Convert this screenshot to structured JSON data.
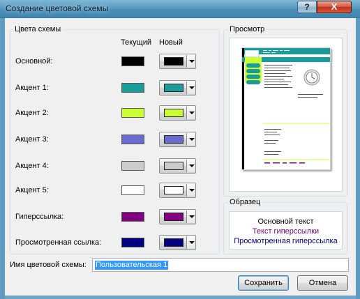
{
  "window": {
    "title": "Создание цветовой схемы",
    "help_glyph": "?",
    "close_glyph": "X"
  },
  "scheme_colors": {
    "group_label": "Цвета схемы",
    "current_header": "Текущий",
    "new_header": "Новый",
    "rows": [
      {
        "label": "Основной:",
        "current": "#000000",
        "new": "#000000"
      },
      {
        "label": "Акцент 1:",
        "current": "#1a9c9a",
        "new": "#1a9c9a"
      },
      {
        "label": "Акцент 2:",
        "current": "#ccff33",
        "new": "#ccff33"
      },
      {
        "label": "Акцент 3:",
        "current": "#6b6bcf",
        "new": "#6b6bcf"
      },
      {
        "label": "Акцент 4:",
        "current": "#cccccc",
        "new": "#cccccc"
      },
      {
        "label": "Акцент 5:",
        "current": "#ffffff",
        "new": "#ffffff"
      },
      {
        "label": "Гиперссылка:",
        "current": "#800080",
        "new": "#800080"
      },
      {
        "label": "Просмотренная ссылка:",
        "current": "#000080",
        "new": "#000080"
      }
    ]
  },
  "preview": {
    "group_label": "Просмотр",
    "accent_teal": "#1a9c9a",
    "accent_lime": "#ccff33"
  },
  "sample": {
    "group_label": "Образец",
    "main_text": "Основной текст",
    "hyperlink_text": "Текст гиперссылки",
    "visited_text": "Просмотренная гиперссылка",
    "main_color": "#000000",
    "hyperlink_color": "#800080",
    "visited_color": "#000080"
  },
  "scheme_name": {
    "label": "Имя цветовой схемы:",
    "value": "Пользовательская 1"
  },
  "buttons": {
    "save": "Сохранить",
    "cancel": "Отмена"
  }
}
